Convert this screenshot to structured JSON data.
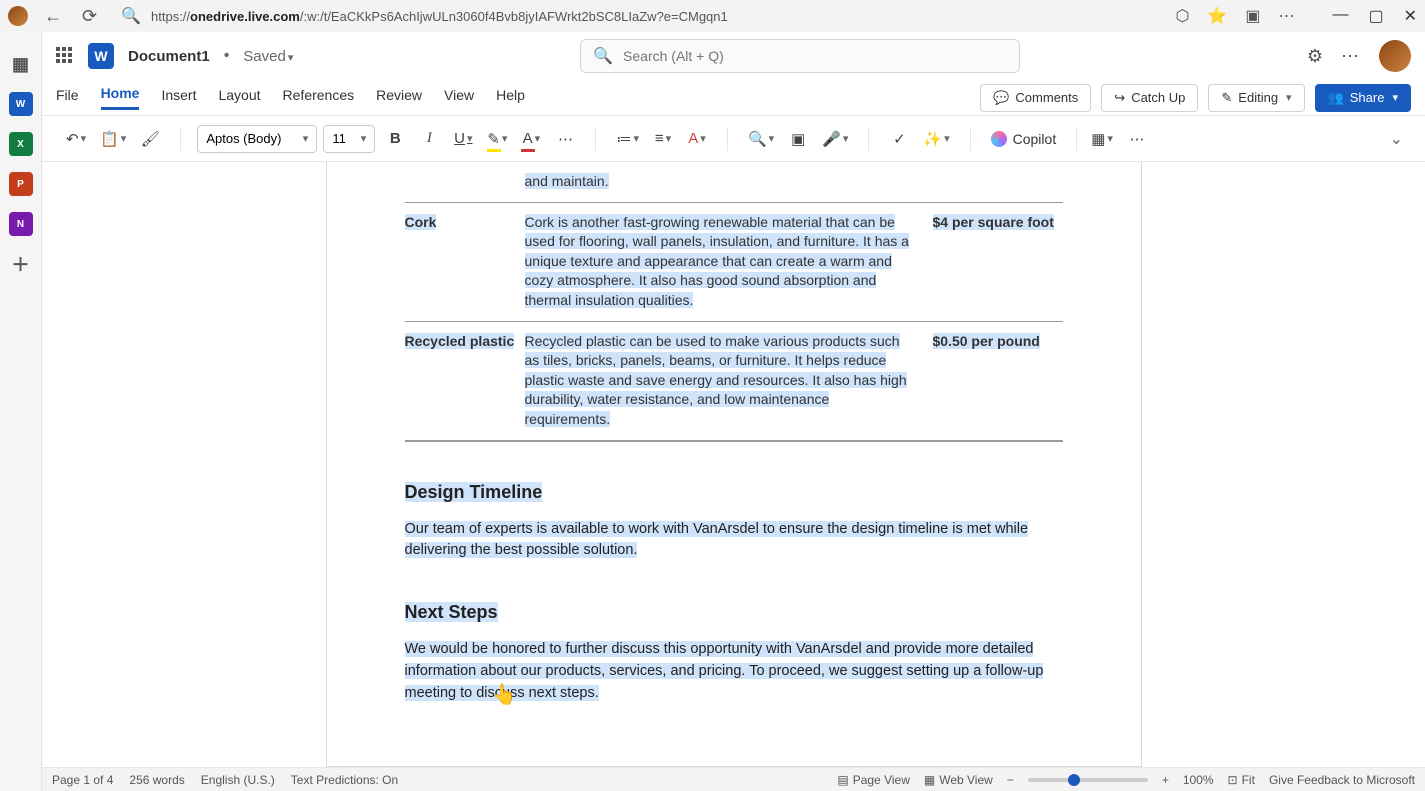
{
  "browser": {
    "url_prefix": "https://",
    "url_host": "onedrive.live.com",
    "url_path": "/:w:/t/EaCKkPs6AchIjwULn3060f4Bvb8jyIAFWrkt2bSC8LIaZw?e=CMgqn1"
  },
  "title": {
    "doc_name": "Document1",
    "save_state": "Saved",
    "search_placeholder": "Search (Alt + Q)"
  },
  "ribbon": {
    "tabs": [
      "File",
      "Home",
      "Insert",
      "Layout",
      "References",
      "Review",
      "View",
      "Help"
    ],
    "active": "Home",
    "comments": "Comments",
    "catchup": "Catch Up",
    "editing": "Editing",
    "share": "Share"
  },
  "toolbar": {
    "font": "Aptos (Body)",
    "size": "11",
    "copilot": "Copilot"
  },
  "document": {
    "row0_desc_tail": "and maintain.",
    "row1": {
      "name": "Cork",
      "desc": "Cork is another fast-growing renewable material that can be used for flooring, wall panels, insulation, and furniture. It has a unique texture and appearance that can create a warm and cozy atmosphere. It also has good sound absorption and thermal insulation qualities.",
      "price": "$4 per square foot"
    },
    "row2": {
      "name": "Recycled plastic",
      "desc": "Recycled plastic can be used to make various products such as tiles, bricks, panels, beams, or furniture. It helps reduce plastic waste and save energy and resources. It also has high durability, water resistance, and low maintenance requirements.",
      "price": "$0.50 per pound"
    },
    "h2a": "Design Timeline",
    "p1": "Our team of experts is available to work with VanArsdel to ensure the design timeline is met while delivering the best possible solution.",
    "h2b": "Next Steps",
    "p2": "We would be honored to further discuss this opportunity with VanArsdel and provide more detailed information about our products, services, and pricing. To proceed, we suggest setting up a follow-up meeting to discuss next steps."
  },
  "status": {
    "page": "Page 1 of 4",
    "words": "256 words",
    "lang": "English (U.S.)",
    "predict": "Text Predictions: On",
    "pageview": "Page View",
    "webview": "Web View",
    "zoom": "100%",
    "fit": "Fit",
    "feedback": "Give Feedback to Microsoft"
  }
}
